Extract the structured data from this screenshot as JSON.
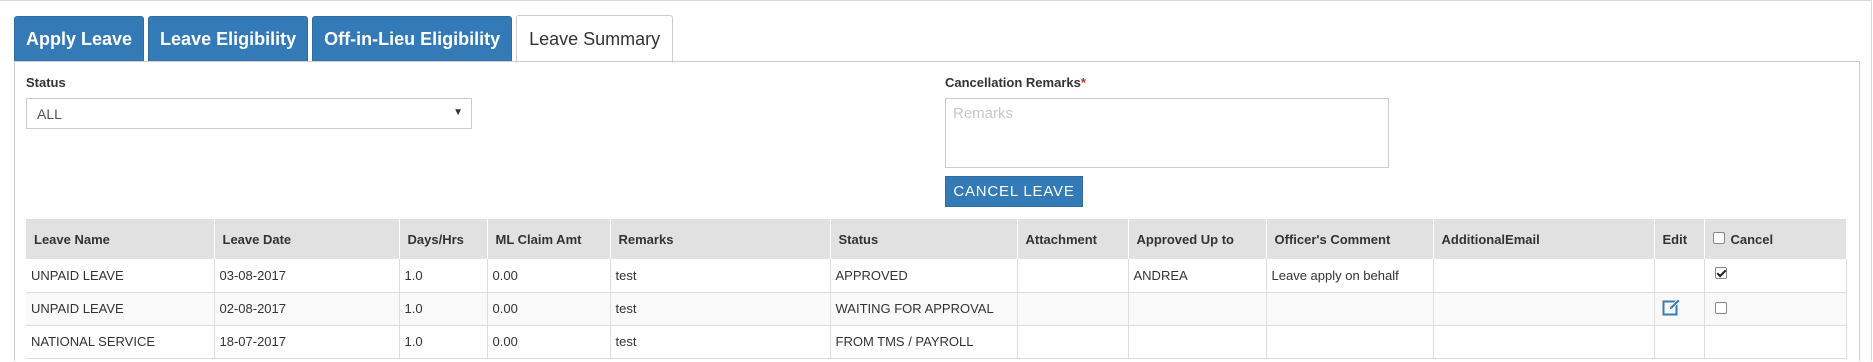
{
  "tabs": [
    {
      "label": "Apply Leave",
      "active": false
    },
    {
      "label": "Leave Eligibility",
      "active": false
    },
    {
      "label": "Off-in-Lieu Eligibility",
      "active": false
    },
    {
      "label": "Leave Summary",
      "active": true
    }
  ],
  "filters": {
    "status_label": "Status",
    "status_value": "ALL",
    "remarks_label": "Cancellation Remarks",
    "remarks_required_mark": "*",
    "remarks_placeholder": "Remarks",
    "cancel_button": "CANCEL LEAVE"
  },
  "table": {
    "headers": [
      "Leave Name",
      "Leave Date",
      "Days/Hrs",
      "ML Claim Amt",
      "Remarks",
      "Status",
      "Attachment",
      "Approved Up to",
      "Officer's Comment",
      "AdditionalEmail",
      "Edit",
      "Cancel"
    ],
    "rows": [
      {
        "leave_name": "UNPAID LEAVE",
        "leave_date": "03-08-2017",
        "days": "1.0",
        "ml_claim": "0.00",
        "remarks": "test",
        "status": "APPROVED",
        "attachment": "",
        "approved_up_to": "ANDREA",
        "officer_comment": "Leave apply on behalf",
        "additional_email": "",
        "editable": false,
        "cancel_checked": true
      },
      {
        "leave_name": "UNPAID LEAVE",
        "leave_date": "02-08-2017",
        "days": "1.0",
        "ml_claim": "0.00",
        "remarks": "test",
        "status": "WAITING FOR APPROVAL",
        "attachment": "",
        "approved_up_to": "",
        "officer_comment": "",
        "additional_email": "",
        "editable": true,
        "cancel_checked": false
      },
      {
        "leave_name": "NATIONAL SERVICE",
        "leave_date": "18-07-2017",
        "days": "1.0",
        "ml_claim": "0.00",
        "remarks": "test",
        "status": "FROM TMS / PAYROLL",
        "attachment": "",
        "approved_up_to": "",
        "officer_comment": "",
        "additional_email": "",
        "editable": false,
        "cancel_checked": false
      }
    ]
  },
  "colors": {
    "primary": "#337ab7",
    "header_bg": "#e1e1e1",
    "required": "#c9302c"
  }
}
